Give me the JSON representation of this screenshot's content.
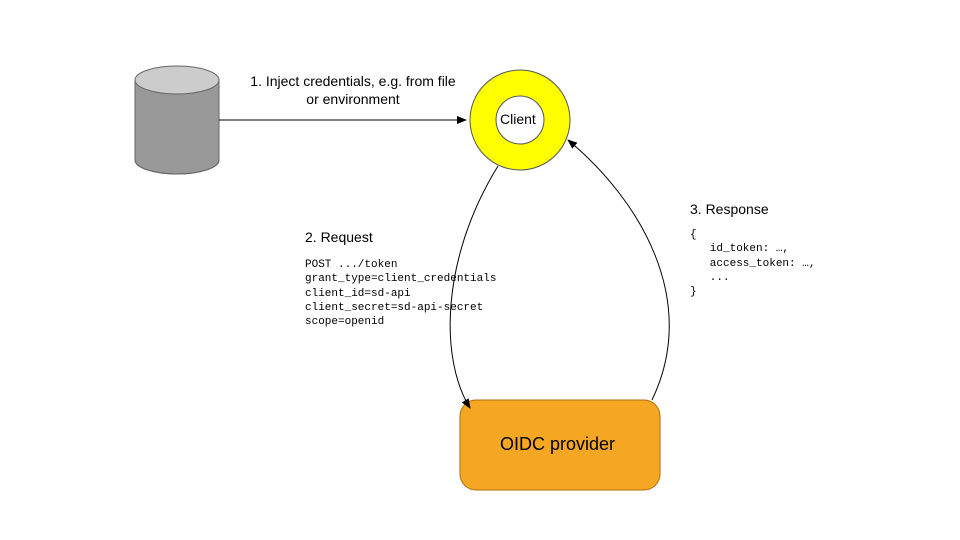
{
  "nodes": {
    "storage": {
      "kind": "cylinder"
    },
    "client": {
      "label": "Client"
    },
    "provider": {
      "label": "OIDC provider"
    }
  },
  "steps": {
    "s1": {
      "title": "1. Inject credentials, e.g. from file\nor environment"
    },
    "s2": {
      "title": "2. Request",
      "body": "POST .../token\ngrant_type=client_credentials\nclient_id=sd-api\nclient_secret=sd-api-secret\nscope=openid"
    },
    "s3": {
      "title": "3. Response",
      "body": "{\n   id_token: …,\n   access_token: …,\n   ...\n}"
    }
  },
  "colors": {
    "cylinder_fill": "#999999",
    "cylinder_top": "#cccccc",
    "cylinder_stroke": "#666666",
    "client_ring": "#ffff00",
    "client_stroke": "#555555",
    "provider_fill": "#f5a623",
    "provider_stroke": "#b26f0a",
    "arrow": "#000000"
  }
}
